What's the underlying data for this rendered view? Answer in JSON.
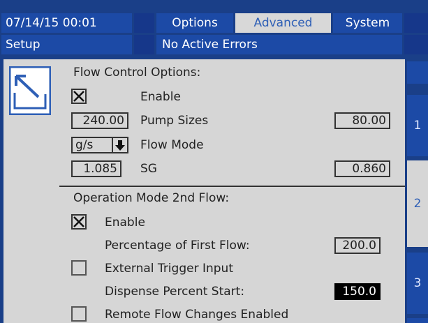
{
  "header": {
    "datetime": "07/14/15 00:01",
    "tabs": {
      "options": "Options",
      "advanced": "Advanced",
      "system": "System"
    },
    "screen": "Setup",
    "status": "No Active Errors"
  },
  "flow_control": {
    "title": "Flow Control Options:",
    "enable_label": "Enable",
    "enable_checked": true,
    "pump_size_1": "240.00",
    "pump_sizes_label": "Pump Sizes",
    "pump_size_2": "80.00",
    "flow_mode_unit": "g/s",
    "flow_mode_label": "Flow Mode",
    "sg_1": "1.085",
    "sg_label": "SG",
    "sg_2": "0.860"
  },
  "second_flow": {
    "title": "Operation Mode 2nd Flow:",
    "enable_label": "Enable",
    "enable_checked": true,
    "percentage_label": "Percentage of First Flow:",
    "percentage_value": "200.0",
    "external_trigger_label": "External Trigger Input",
    "external_trigger_checked": false,
    "dispense_label": "Dispense Percent Start:",
    "dispense_value": "150.0",
    "remote_label": "Remote Flow Changes Enabled",
    "remote_checked": false
  },
  "side_tabs": [
    "1",
    "2",
    "3"
  ],
  "selected_side_tab": "2",
  "icons": {
    "screen_icon": "flow-control-icon",
    "dropdown": "arrow-down-icon",
    "check": "x-mark-icon"
  },
  "colors": {
    "bar_blue": "#1c4aa6",
    "panel_grey": "#d6d6d6",
    "accent_text": "#2e5fb6",
    "highlight_field": "#000000"
  }
}
